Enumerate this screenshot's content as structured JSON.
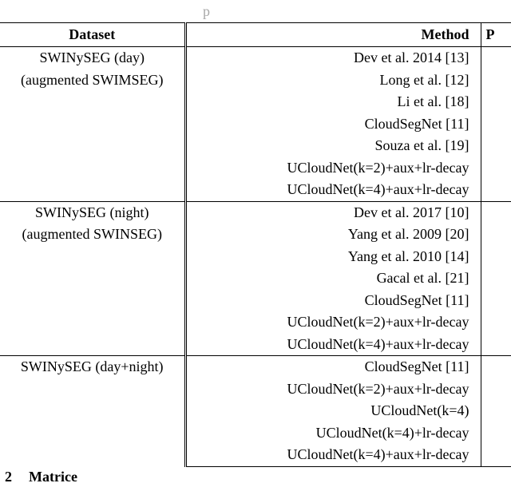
{
  "top_fragment": "p",
  "headers": {
    "dataset": "Dataset",
    "method": "Method",
    "p": "P"
  },
  "groups": [
    {
      "dataset_lines": [
        "SWINySEG (day)",
        "(augmented SWIMSEG)"
      ],
      "methods": [
        "Dev et al. 2014 [13]",
        "Long et al. [12]",
        "Li et al. [18]",
        "CloudSegNet [11]",
        "Souza et al. [19]",
        "UCloudNet(k=2)+aux+lr-decay",
        "UCloudNet(k=4)+aux+lr-decay"
      ]
    },
    {
      "dataset_lines": [
        "SWINySEG (night)",
        "(augmented SWINSEG)"
      ],
      "methods": [
        "Dev et al. 2017 [10]",
        "Yang et al. 2009 [20]",
        "Yang et al. 2010 [14]",
        "Gacal et al. [21]",
        "CloudSegNet [11]",
        "UCloudNet(k=2)+aux+lr-decay",
        "UCloudNet(k=4)+aux+lr-decay"
      ]
    },
    {
      "dataset_lines": [
        "SWINySEG (day+night)"
      ],
      "methods": [
        "CloudSegNet [11]",
        "UCloudNet(k=2)+aux+lr-decay",
        "UCloudNet(k=4)",
        "UCloudNet(k=4)+lr-decay",
        "UCloudNet(k=4)+aux+lr-decay"
      ]
    }
  ],
  "section": {
    "number": "2",
    "title_fragment": "Matrice"
  },
  "chart_data": {
    "type": "table",
    "title": "",
    "columns": [
      "Dataset",
      "Method",
      "P"
    ],
    "rows": [
      [
        "SWINySEG (day) (augmented SWIMSEG)",
        "Dev et al. 2014 [13]",
        null
      ],
      [
        "SWINySEG (day) (augmented SWIMSEG)",
        "Long et al. [12]",
        null
      ],
      [
        "SWINySEG (day) (augmented SWIMSEG)",
        "Li et al. [18]",
        null
      ],
      [
        "SWINySEG (day) (augmented SWIMSEG)",
        "CloudSegNet [11]",
        null
      ],
      [
        "SWINySEG (day) (augmented SWIMSEG)",
        "Souza et al. [19]",
        null
      ],
      [
        "SWINySEG (day) (augmented SWIMSEG)",
        "UCloudNet(k=2)+aux+lr-decay",
        null
      ],
      [
        "SWINySEG (day) (augmented SWIMSEG)",
        "UCloudNet(k=4)+aux+lr-decay",
        null
      ],
      [
        "SWINySEG (night) (augmented SWINSEG)",
        "Dev et al. 2017 [10]",
        null
      ],
      [
        "SWINySEG (night) (augmented SWINSEG)",
        "Yang et al. 2009 [20]",
        null
      ],
      [
        "SWINySEG (night) (augmented SWINSEG)",
        "Yang et al. 2010 [14]",
        null
      ],
      [
        "SWINySEG (night) (augmented SWINSEG)",
        "Gacal et al. [21]",
        null
      ],
      [
        "SWINySEG (night) (augmented SWINSEG)",
        "CloudSegNet [11]",
        null
      ],
      [
        "SWINySEG (night) (augmented SWINSEG)",
        "UCloudNet(k=2)+aux+lr-decay",
        null
      ],
      [
        "SWINySEG (night) (augmented SWINSEG)",
        "UCloudNet(k=4)+aux+lr-decay",
        null
      ],
      [
        "SWINySEG (day+night)",
        "CloudSegNet [11]",
        null
      ],
      [
        "SWINySEG (day+night)",
        "UCloudNet(k=2)+aux+lr-decay",
        null
      ],
      [
        "SWINySEG (day+night)",
        "UCloudNet(k=4)",
        null
      ],
      [
        "SWINySEG (day+night)",
        "UCloudNet(k=4)+lr-decay",
        null
      ],
      [
        "SWINySEG (day+night)",
        "UCloudNet(k=4)+aux+lr-decay",
        null
      ]
    ]
  }
}
